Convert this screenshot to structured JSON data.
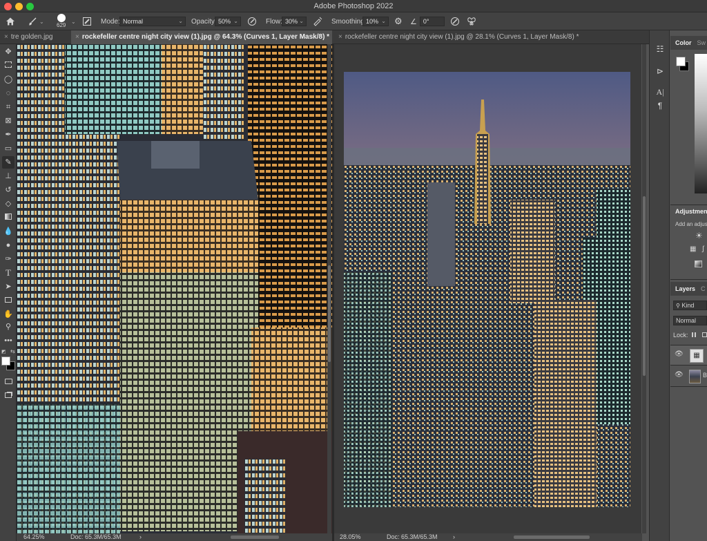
{
  "window": {
    "title": "Adobe Photoshop 2022"
  },
  "options_bar": {
    "brush_size": "629",
    "mode_label": "Mode:",
    "mode_value": "Normal",
    "opacity_label": "Opacity:",
    "opacity_value": "50%",
    "flow_label": "Flow:",
    "flow_value": "30%",
    "smoothing_label": "Smoothing:",
    "smoothing_value": "10%",
    "angle_value": "0°"
  },
  "tabs": [
    {
      "label": "tre golden.jpg"
    },
    {
      "label": "rockefeller centre night city view (1).jpg @ 64.3% (Curves 1, Layer Mask/8) *"
    },
    {
      "label": "rockefeller centre night city view (1).jpg @ 28.1% (Curves 1, Layer Mask/8) *"
    }
  ],
  "status": {
    "doc1_zoom": "64.25%",
    "doc1_info": "Doc: 65.3M/65.3M",
    "doc2_zoom": "28.05%",
    "doc2_info": "Doc: 65.3M/65.3M"
  },
  "panels": {
    "color_tab": "Color",
    "swatches_tab": "Sw",
    "adjustments_title": "Adjustment",
    "adjustments_hint": "Add an adjus",
    "layers_tab": "Layers",
    "layers_tab2": "C",
    "kind_filter": "Kind",
    "blend_mode": "Normal",
    "lock_label": "Lock:",
    "layer2_initial": "B"
  },
  "colors": {
    "foreground": "#ffffff",
    "background": "#000000",
    "accent": "#4a90d9"
  }
}
